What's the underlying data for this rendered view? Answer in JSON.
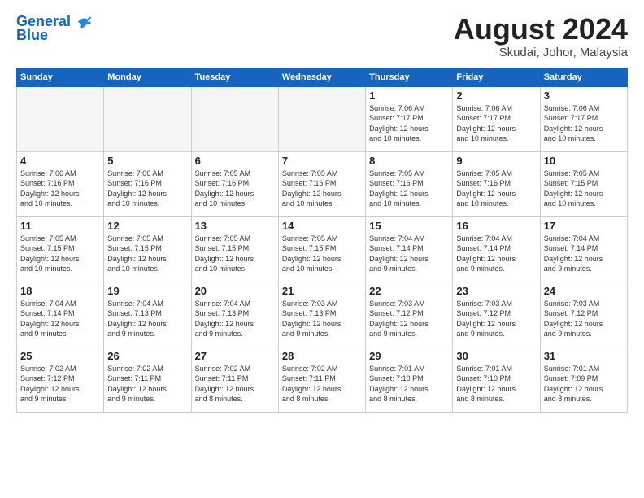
{
  "logo": {
    "line1": "General",
    "line2": "Blue"
  },
  "title": "August 2024",
  "subtitle": "Skudai, Johor, Malaysia",
  "weekdays": [
    "Sunday",
    "Monday",
    "Tuesday",
    "Wednesday",
    "Thursday",
    "Friday",
    "Saturday"
  ],
  "weeks": [
    [
      {
        "day": "",
        "info": ""
      },
      {
        "day": "",
        "info": ""
      },
      {
        "day": "",
        "info": ""
      },
      {
        "day": "",
        "info": ""
      },
      {
        "day": "1",
        "info": "Sunrise: 7:06 AM\nSunset: 7:17 PM\nDaylight: 12 hours\nand 10 minutes."
      },
      {
        "day": "2",
        "info": "Sunrise: 7:06 AM\nSunset: 7:17 PM\nDaylight: 12 hours\nand 10 minutes."
      },
      {
        "day": "3",
        "info": "Sunrise: 7:06 AM\nSunset: 7:17 PM\nDaylight: 12 hours\nand 10 minutes."
      }
    ],
    [
      {
        "day": "4",
        "info": "Sunrise: 7:06 AM\nSunset: 7:16 PM\nDaylight: 12 hours\nand 10 minutes."
      },
      {
        "day": "5",
        "info": "Sunrise: 7:06 AM\nSunset: 7:16 PM\nDaylight: 12 hours\nand 10 minutes."
      },
      {
        "day": "6",
        "info": "Sunrise: 7:05 AM\nSunset: 7:16 PM\nDaylight: 12 hours\nand 10 minutes."
      },
      {
        "day": "7",
        "info": "Sunrise: 7:05 AM\nSunset: 7:16 PM\nDaylight: 12 hours\nand 10 minutes."
      },
      {
        "day": "8",
        "info": "Sunrise: 7:05 AM\nSunset: 7:16 PM\nDaylight: 12 hours\nand 10 minutes."
      },
      {
        "day": "9",
        "info": "Sunrise: 7:05 AM\nSunset: 7:16 PM\nDaylight: 12 hours\nand 10 minutes."
      },
      {
        "day": "10",
        "info": "Sunrise: 7:05 AM\nSunset: 7:15 PM\nDaylight: 12 hours\nand 10 minutes."
      }
    ],
    [
      {
        "day": "11",
        "info": "Sunrise: 7:05 AM\nSunset: 7:15 PM\nDaylight: 12 hours\nand 10 minutes."
      },
      {
        "day": "12",
        "info": "Sunrise: 7:05 AM\nSunset: 7:15 PM\nDaylight: 12 hours\nand 10 minutes."
      },
      {
        "day": "13",
        "info": "Sunrise: 7:05 AM\nSunset: 7:15 PM\nDaylight: 12 hours\nand 10 minutes."
      },
      {
        "day": "14",
        "info": "Sunrise: 7:05 AM\nSunset: 7:15 PM\nDaylight: 12 hours\nand 10 minutes."
      },
      {
        "day": "15",
        "info": "Sunrise: 7:04 AM\nSunset: 7:14 PM\nDaylight: 12 hours\nand 9 minutes."
      },
      {
        "day": "16",
        "info": "Sunrise: 7:04 AM\nSunset: 7:14 PM\nDaylight: 12 hours\nand 9 minutes."
      },
      {
        "day": "17",
        "info": "Sunrise: 7:04 AM\nSunset: 7:14 PM\nDaylight: 12 hours\nand 9 minutes."
      }
    ],
    [
      {
        "day": "18",
        "info": "Sunrise: 7:04 AM\nSunset: 7:14 PM\nDaylight: 12 hours\nand 9 minutes."
      },
      {
        "day": "19",
        "info": "Sunrise: 7:04 AM\nSunset: 7:13 PM\nDaylight: 12 hours\nand 9 minutes."
      },
      {
        "day": "20",
        "info": "Sunrise: 7:04 AM\nSunset: 7:13 PM\nDaylight: 12 hours\nand 9 minutes."
      },
      {
        "day": "21",
        "info": "Sunrise: 7:03 AM\nSunset: 7:13 PM\nDaylight: 12 hours\nand 9 minutes."
      },
      {
        "day": "22",
        "info": "Sunrise: 7:03 AM\nSunset: 7:12 PM\nDaylight: 12 hours\nand 9 minutes."
      },
      {
        "day": "23",
        "info": "Sunrise: 7:03 AM\nSunset: 7:12 PM\nDaylight: 12 hours\nand 9 minutes."
      },
      {
        "day": "24",
        "info": "Sunrise: 7:03 AM\nSunset: 7:12 PM\nDaylight: 12 hours\nand 9 minutes."
      }
    ],
    [
      {
        "day": "25",
        "info": "Sunrise: 7:02 AM\nSunset: 7:12 PM\nDaylight: 12 hours\nand 9 minutes."
      },
      {
        "day": "26",
        "info": "Sunrise: 7:02 AM\nSunset: 7:11 PM\nDaylight: 12 hours\nand 9 minutes."
      },
      {
        "day": "27",
        "info": "Sunrise: 7:02 AM\nSunset: 7:11 PM\nDaylight: 12 hours\nand 8 minutes."
      },
      {
        "day": "28",
        "info": "Sunrise: 7:02 AM\nSunset: 7:11 PM\nDaylight: 12 hours\nand 8 minutes."
      },
      {
        "day": "29",
        "info": "Sunrise: 7:01 AM\nSunset: 7:10 PM\nDaylight: 12 hours\nand 8 minutes."
      },
      {
        "day": "30",
        "info": "Sunrise: 7:01 AM\nSunset: 7:10 PM\nDaylight: 12 hours\nand 8 minutes."
      },
      {
        "day": "31",
        "info": "Sunrise: 7:01 AM\nSunset: 7:09 PM\nDaylight: 12 hours\nand 8 minutes."
      }
    ]
  ]
}
